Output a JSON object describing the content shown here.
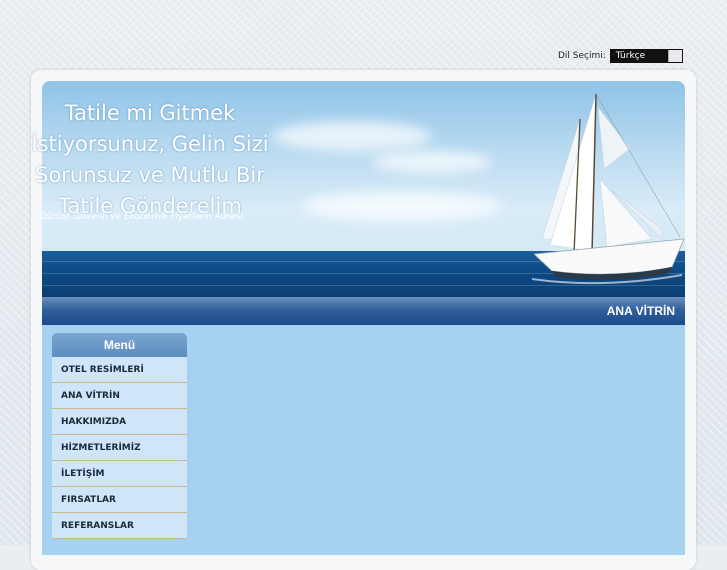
{
  "language": {
    "label": "Dil Seçimi:",
    "selected": "Türkçe"
  },
  "header": {
    "title_lines": [
      "Tatile mi Gitmek",
      "İstiyorsunuz, Gelin Sizi",
      "Sorunsuz ve Mutlu Bir",
      "Tatile Gönderelim"
    ],
    "subtitle": "Dürüst Güvenli ve Ekonomik Fiyatların Adresi"
  },
  "nav": {
    "active_label": "ANA VİTRİN"
  },
  "sidebar": {
    "header": "Menü",
    "items": [
      {
        "label": "OTEL RESİMLERİ"
      },
      {
        "label": "ANA VİTRİN"
      },
      {
        "label": "HAKKIMIZDA"
      },
      {
        "label": "HİZMETLERİMİZ"
      },
      {
        "label": "İLETİŞİM"
      },
      {
        "label": "FIRSATLAR"
      },
      {
        "label": "REFERANSLAR"
      }
    ]
  },
  "colors": {
    "nav_bar": "#1d4a88",
    "content_bg": "#a6d1f1",
    "menu_header": "#5d8ec0",
    "menu_item_bg": "#cfe6f8"
  }
}
